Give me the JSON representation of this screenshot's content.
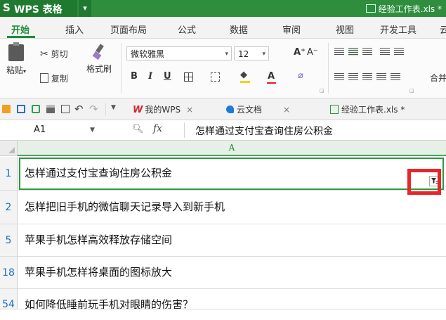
{
  "app": {
    "logo_letter": "S",
    "name": "WPS 表格",
    "menu_arrow": "▾",
    "window_file": "经验工作表.xls *"
  },
  "menu_tabs": [
    "开始",
    "插入",
    "页面布局",
    "公式",
    "数据",
    "审阅",
    "视图",
    "开发工具",
    "云"
  ],
  "ribbon": {
    "paste": "粘贴",
    "cut": "剪切",
    "copy": "复制",
    "format_painter": "格式刷",
    "font_name": "微软雅黑",
    "font_size": "12",
    "grow_font": "A⁺",
    "shrink_font": "A⁻",
    "bold": "B",
    "italic": "I",
    "underline": "U",
    "merge": "合并",
    "dropdown_arrow": "▾",
    "launcher_glyph": "◲"
  },
  "quick_access": {
    "tabs": [
      {
        "label": "我的WPS",
        "badge": "W"
      },
      {
        "label": "云文档"
      },
      {
        "label": "经验工作表.xls *"
      }
    ],
    "close_glyph": "×",
    "tab_list_arrow": "▼"
  },
  "formula_bar": {
    "cell_ref": "A1",
    "fx": "fx",
    "formula": "怎样通过支付宝查询住房公积金"
  },
  "grid": {
    "column_header": "A",
    "rows": [
      {
        "row": "1",
        "text": "怎样通过支付宝查询住房公积金"
      },
      {
        "row": "2",
        "text": "怎样把旧手机的微信聊天记录导入到新手机"
      },
      {
        "row": "5",
        "text": "苹果手机怎样高效释放存储空间"
      },
      {
        "row": "18",
        "text": "苹果手机怎样将桌面的图标放大"
      },
      {
        "row": "54",
        "text": "如何降低睡前玩手机对眼睛的伤害？"
      }
    ]
  },
  "colors": {
    "brand_green": "#2f8e3e",
    "active_cell_border": "#2b9a3f",
    "row_number": "#1e6fb8",
    "highlight": "#e8262a"
  },
  "icons": [
    "paste-icon",
    "scissors-icon",
    "copy-icon",
    "format-painter-icon",
    "folder-icon",
    "save-icon",
    "print-icon",
    "preview-icon",
    "undo-icon",
    "redo-icon",
    "zoom-icon",
    "filter-icon"
  ]
}
